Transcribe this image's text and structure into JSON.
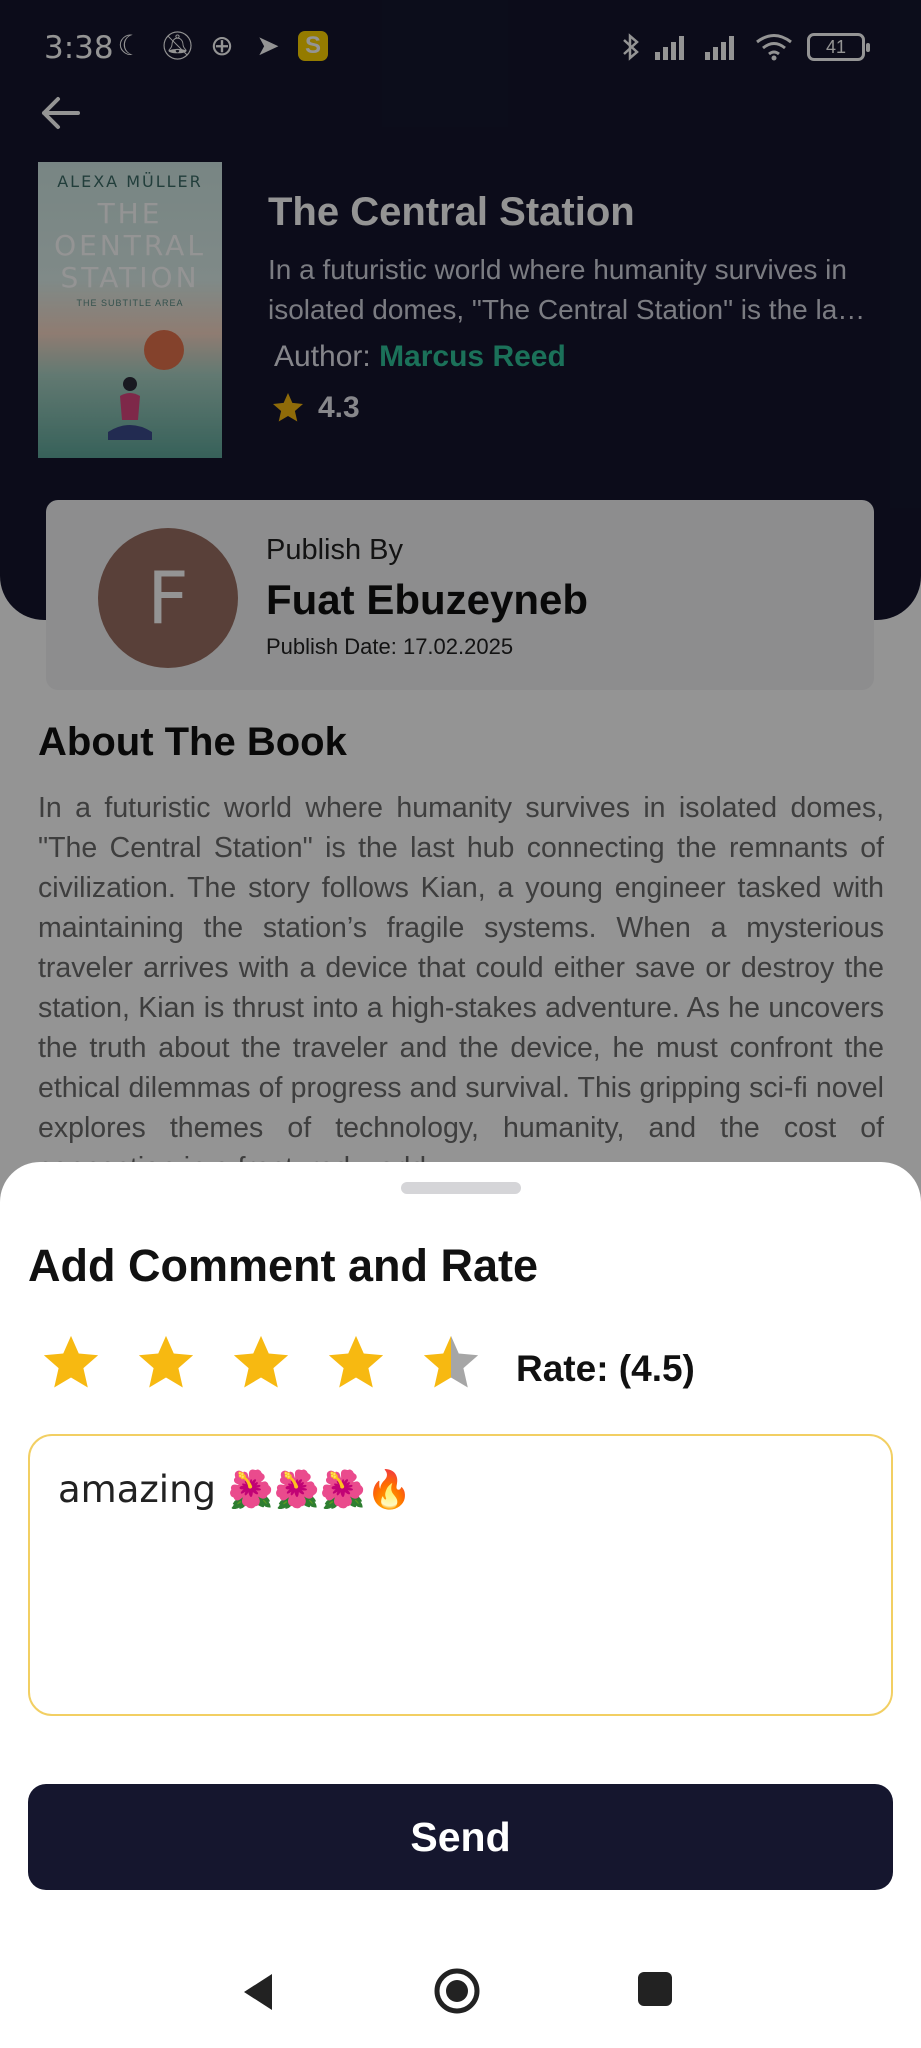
{
  "status_bar": {
    "time": "3:38",
    "battery": "41",
    "badge": "S"
  },
  "book": {
    "title": "The Central Station",
    "description": "In a futuristic world where humanity survives in isolated domes, \"The Central Station\" is the la…",
    "author_prefix": "Author: ",
    "author_name": "Marcus Reed",
    "rating": "4.3",
    "cover": {
      "author": "ALEXA MÜLLER",
      "title": "THE OENTRAL STATION",
      "subtitle": "THE SUBTITLE AREA"
    }
  },
  "publisher": {
    "avatar_letter": "F",
    "label": "Publish By",
    "name": "Fuat Ebuzeyneb",
    "date": "Publish Date: 17.02.2025"
  },
  "about": {
    "heading": "About The Book",
    "body": "In a futuristic world where humanity survives in isolated domes, \"The Central Station\" is the last hub connecting the remnants of civilization. The story follows Kian, a young engineer tasked with maintaining the station’s fragile systems. When a mysterious traveler arrives with a device that could either save or destroy the station, Kian is thrust into a high-stakes adventure. As he uncovers the truth about the traveler and the device, he must confront the ethical dilemmas of progress and survival. This gripping sci-fi novel explores themes of technology, humanity, and the cost of connection in a fractured world."
  },
  "sheet": {
    "title": "Add Comment and Rate",
    "rating_value": 4.5,
    "rate_label": "Rate: (4.5)",
    "comment": "amazing 🌺🌺🌺🔥",
    "send_label": "Send"
  },
  "colors": {
    "header_bg": "#15162e",
    "accent_green": "#2fc39a",
    "star_gold": "#f7b911",
    "star_gray": "#a6a6a6",
    "input_border": "#f2cf63"
  }
}
